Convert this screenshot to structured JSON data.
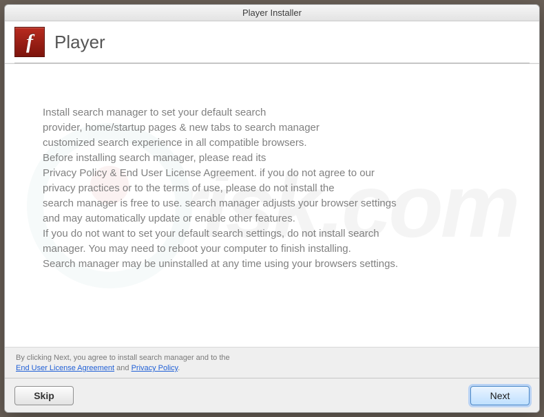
{
  "window": {
    "title": "Player Installer"
  },
  "header": {
    "app_title": "Player",
    "icon_glyph": "f"
  },
  "body": {
    "text": "Install search manager to set your default search\nprovider, home/startup pages & new tabs to search manager\ncustomized search experience in all compatible browsers.\nBefore installing search manager, please read its\nPrivacy Policy & End User License Agreement. if you do not agree to our\nprivacy practices or to the terms of use, please do not install the\nsearch manager is free to use. search manager adjusts your browser settings\nand may automatically update or enable other features.\nIf you do not want to set your default search settings, do not install search\nmanager. You may need to reboot your computer to finish installing.\nSearch manager may be uninstalled at any time using your browsers settings."
  },
  "agreement": {
    "prefix": "By clicking Next, you agree to install search manager and to the",
    "eula": "End User License Agreement",
    "and": " and ",
    "pp": "Privacy Policy",
    "suffix": "."
  },
  "footer": {
    "skip_label": "Skip",
    "next_label": "Next"
  },
  "watermark": {
    "text": "risk.com"
  }
}
